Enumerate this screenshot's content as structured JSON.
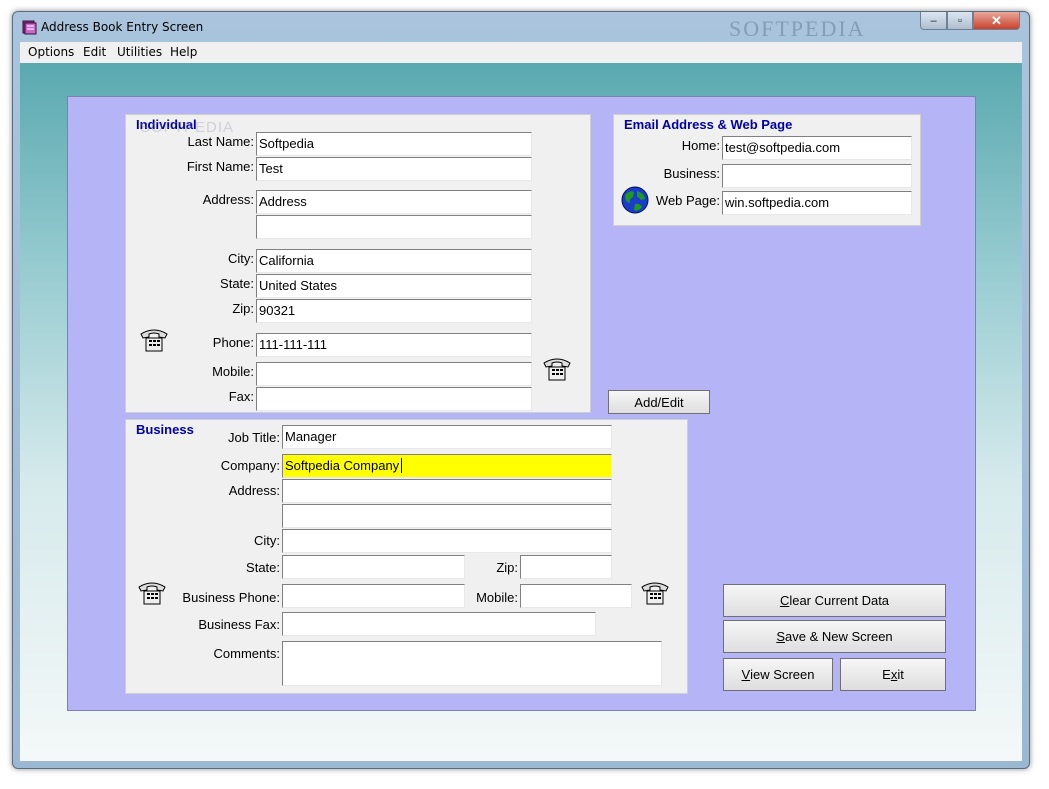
{
  "window": {
    "title": "Address Book Entry Screen",
    "watermark": "SOFTPEDIA",
    "controls": {
      "minimize": "–",
      "maximize": "▫",
      "close": "✕"
    }
  },
  "menu": [
    "Options",
    "Edit",
    "Utilities",
    "Help"
  ],
  "individual": {
    "title": "Individual",
    "watermark": "SOFTPEDIA",
    "labels": {
      "last_name": "Last Name:",
      "first_name": "First Name:",
      "address": "Address:",
      "city": "City:",
      "state": "State:",
      "zip": "Zip:",
      "phone": "Phone:",
      "mobile": "Mobile:",
      "fax": "Fax:"
    },
    "values": {
      "last_name": "Softpedia",
      "first_name": "Test",
      "address1": "Address",
      "address2": "",
      "city": "California",
      "state": "United States",
      "zip": "90321",
      "phone": "111-111-111",
      "mobile": "",
      "fax": ""
    }
  },
  "email": {
    "title": "Email Address & Web Page",
    "labels": {
      "home": "Home:",
      "business": "Business:",
      "web_page": "Web Page:"
    },
    "values": {
      "home": "test@softpedia.com",
      "business": "",
      "web_page": "win.softpedia.com"
    }
  },
  "business": {
    "title": "Business",
    "labels": {
      "job_title": "Job Title:",
      "company": "Company:",
      "address": "Address:",
      "city": "City:",
      "state": "State:",
      "zip": "Zip:",
      "business_phone": "Business Phone:",
      "mobile": "Mobile:",
      "business_fax": "Business Fax:",
      "comments": "Comments:"
    },
    "values": {
      "job_title": "Manager",
      "company": "Softpedia Company",
      "address1": "",
      "address2": "",
      "city": "",
      "state": "",
      "zip": "",
      "business_phone": "",
      "mobile": "",
      "business_fax": "",
      "comments": ""
    }
  },
  "buttons": {
    "add_edit": "Add/Edit",
    "clear_current_data": {
      "mnemonic": "C",
      "rest": "lear Current Data"
    },
    "save_new_screen": {
      "mnemonic": "S",
      "rest": "ave & New Screen"
    },
    "view_screen": {
      "mnemonic": "V",
      "rest": "iew Screen"
    },
    "exit": {
      "pre": "E",
      "mnemonic": "x",
      "rest": "it"
    }
  },
  "colors": {
    "panel": "#b4b4f6",
    "group_title": "#0000aa",
    "focused_field": "#ffff00"
  },
  "icons": [
    "address-book-app-icon",
    "telephone-icon",
    "globe-icon"
  ]
}
